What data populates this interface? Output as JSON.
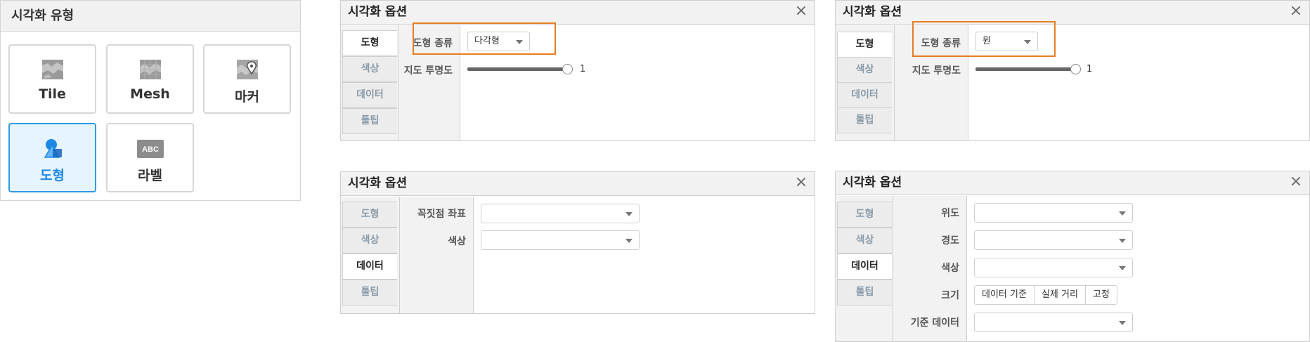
{
  "type_panel": {
    "title": "시각화 유형",
    "items": [
      {
        "label": "Tile",
        "icon": "tile-map-icon",
        "active": false
      },
      {
        "label": "Mesh",
        "icon": "mesh-map-icon",
        "active": false
      },
      {
        "label": "마커",
        "icon": "marker-map-icon",
        "active": false
      },
      {
        "label": "도형",
        "icon": "shape-icon",
        "active": true
      },
      {
        "label": "라벨",
        "icon": "abc-label-icon",
        "icon_text": "ABC",
        "active": false
      }
    ]
  },
  "colors": {
    "accent": "#2e9ae6",
    "highlight": "#e67e22",
    "active_bg": "#e6f4ff"
  },
  "windows": [
    {
      "title": "시각화 옵션",
      "tabs": [
        "도형",
        "색상",
        "데이터",
        "툴팁"
      ],
      "active_tab": "도형",
      "fields": {
        "shape_type_label": "도형 종류",
        "shape_type_value": "다각형",
        "opacity_label": "지도 투명도",
        "opacity_value": "1"
      }
    },
    {
      "title": "시각화 옵션",
      "tabs": [
        "도형",
        "색상",
        "데이터",
        "툴팁"
      ],
      "active_tab": "도형",
      "fields": {
        "shape_type_label": "도형 종류",
        "shape_type_value": "원",
        "opacity_label": "지도 투명도",
        "opacity_value": "1"
      }
    },
    {
      "title": "시각화 옵션",
      "tabs": [
        "도형",
        "색상",
        "데이터",
        "툴팁"
      ],
      "active_tab": "데이터",
      "fields": {
        "vertex_label": "꼭짓점 좌표",
        "vertex_value": "",
        "color_label": "색상",
        "color_value": ""
      }
    },
    {
      "title": "시각화 옵션",
      "tabs": [
        "도형",
        "색상",
        "데이터",
        "툴팁"
      ],
      "active_tab": "데이터",
      "fields": {
        "lat_label": "위도",
        "lat_value": "",
        "lng_label": "경도",
        "lng_value": "",
        "color_label": "색상",
        "color_value": "",
        "size_label": "크기",
        "size_options": [
          "데이터 기준",
          "실제 거리",
          "고정"
        ],
        "base_data_label": "기준 데이터",
        "base_data_value": ""
      }
    }
  ],
  "close_glyph": "×"
}
